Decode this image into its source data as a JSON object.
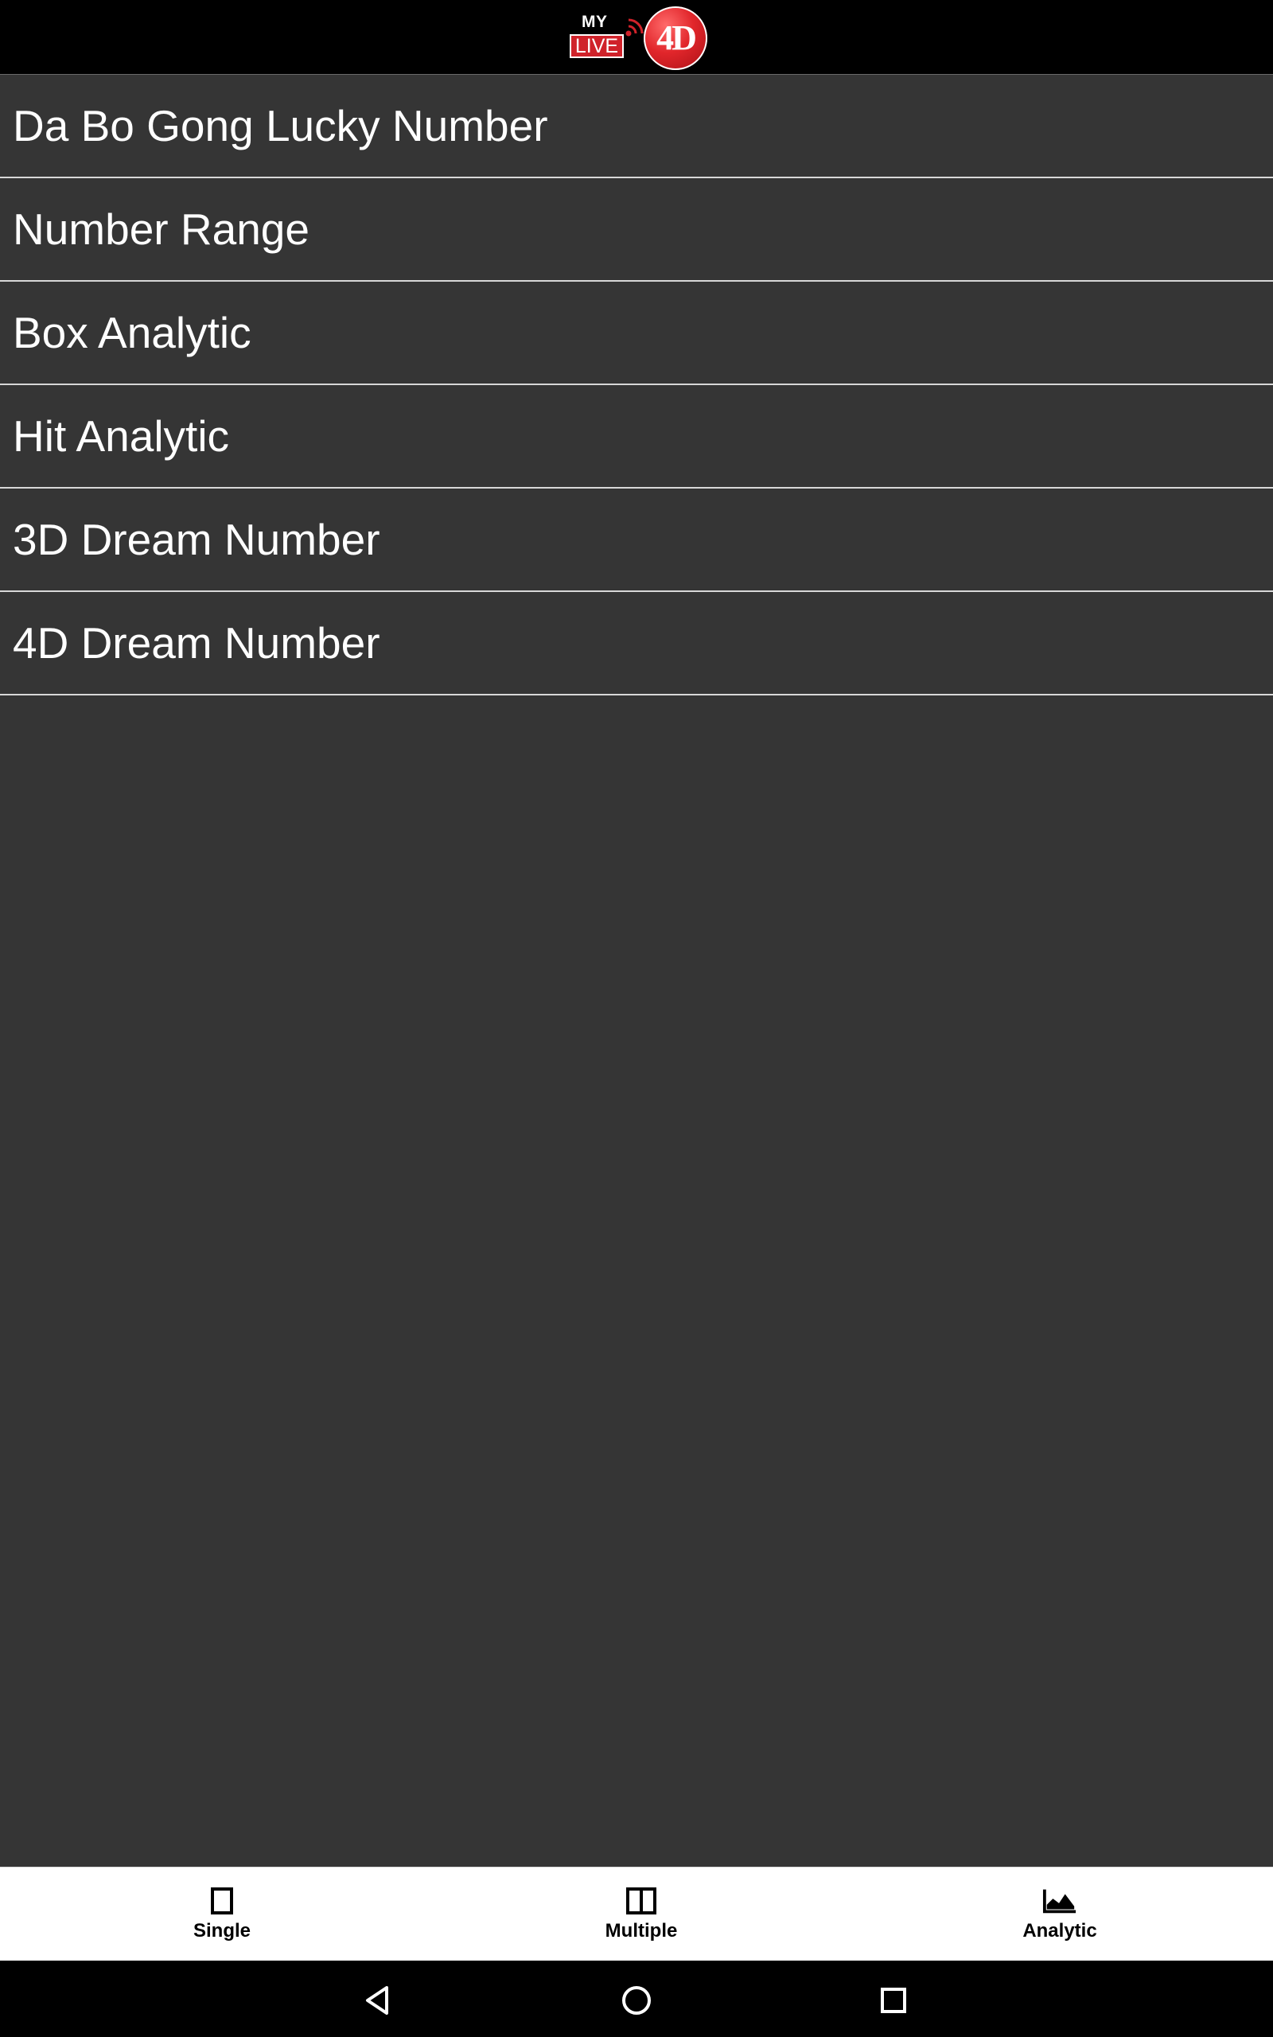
{
  "header": {
    "logo": {
      "my_text": "MY",
      "live_text": "LIVE",
      "ball_text": "4D",
      "brand_red": "#d0222a"
    }
  },
  "menu": {
    "items": [
      {
        "label": "Da Bo Gong Lucky Number"
      },
      {
        "label": "Number Range"
      },
      {
        "label": "Box Analytic"
      },
      {
        "label": "Hit Analytic"
      },
      {
        "label": "3D Dream Number"
      },
      {
        "label": "4D Dream Number"
      }
    ]
  },
  "tabbar": {
    "tabs": [
      {
        "label": "Single",
        "icon": "single-page-icon"
      },
      {
        "label": "Multiple",
        "icon": "multiple-page-icon"
      },
      {
        "label": "Analytic",
        "icon": "area-chart-icon"
      }
    ]
  },
  "navbar": {
    "buttons": [
      {
        "icon": "back-icon"
      },
      {
        "icon": "home-icon"
      },
      {
        "icon": "recents-icon"
      }
    ]
  },
  "colors": {
    "background": "#353535",
    "header": "#000000",
    "divider": "#d8d8d8",
    "tabbar": "#ffffff"
  }
}
